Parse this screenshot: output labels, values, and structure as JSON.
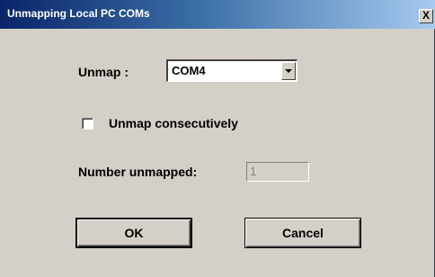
{
  "window": {
    "title": "Unmapping Local PC COMs",
    "close_glyph": "X"
  },
  "unmap": {
    "label": "Unmap :",
    "selected": "COM4"
  },
  "consecutive": {
    "label": "Unmap consecutively",
    "checked": false
  },
  "number_unmapped": {
    "label": "Number unmapped:",
    "value": "1"
  },
  "buttons": {
    "ok": "OK",
    "cancel": "Cancel"
  }
}
